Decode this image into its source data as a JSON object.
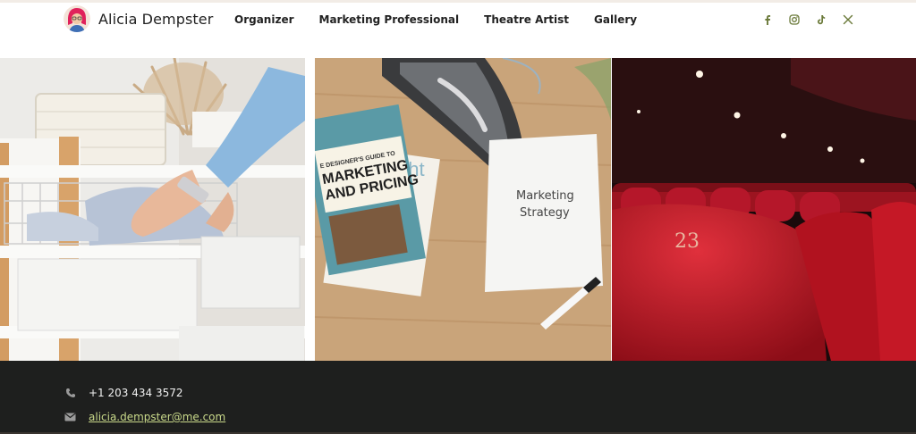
{
  "site": {
    "title": "Alicia Dempster"
  },
  "nav": {
    "items": [
      "Organizer",
      "Marketing Professional",
      "Theatre Artist",
      "Gallery"
    ]
  },
  "social": {
    "icons": [
      "facebook-icon",
      "instagram-icon",
      "tiktok-icon",
      "x-icon"
    ],
    "color": "#6b7a3a"
  },
  "gallery": {
    "book_lines": [
      "E DESIGNER'S GUIDE TO",
      "MARKETING",
      "AND PRICING"
    ],
    "book_back": "ght",
    "note_lines": [
      "Marketing",
      "Strategy"
    ],
    "seat_number": "23"
  },
  "footer": {
    "phone": "+1 203 434 3572",
    "email": "alicia.dempster@me.com"
  },
  "colors": {
    "footer_bg": "#1e1f1e",
    "link": "#c9d98a",
    "accent": "#6b7a3a"
  }
}
